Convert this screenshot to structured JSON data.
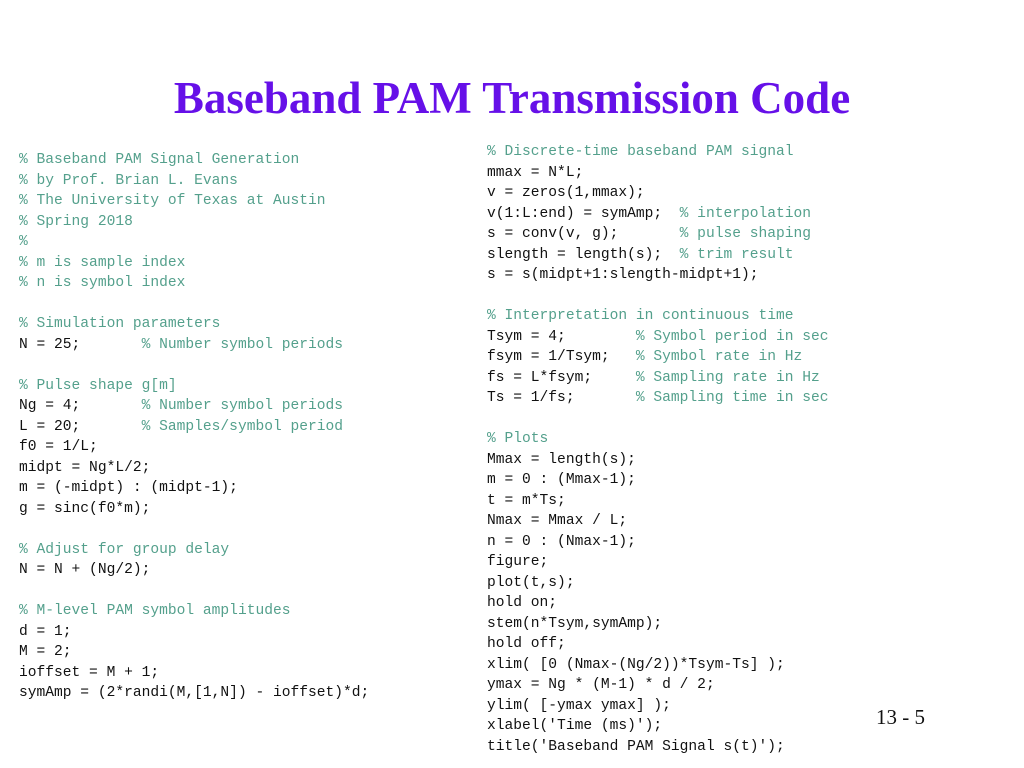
{
  "slide": {
    "title": "Baseband PAM Transmission Code",
    "title_color": "#6610E8",
    "background_color": "#ffffff",
    "page_number": "13 - 5"
  },
  "theme": {
    "code_color": "#111111",
    "comment_color": "#54A08C"
  },
  "code_left": {
    "lines": [
      [
        {
          "t": "comment",
          "s": "% Baseband PAM Signal Generation"
        }
      ],
      [
        {
          "t": "comment",
          "s": "% by Prof. Brian L. Evans"
        }
      ],
      [
        {
          "t": "comment",
          "s": "% The University of Texas at Austin"
        }
      ],
      [
        {
          "t": "comment",
          "s": "% Spring 2018"
        }
      ],
      [
        {
          "t": "comment",
          "s": "%"
        }
      ],
      [
        {
          "t": "comment",
          "s": "% m is sample index"
        }
      ],
      [
        {
          "t": "comment",
          "s": "% n is symbol index"
        }
      ],
      [
        {
          "t": "code",
          "s": ""
        }
      ],
      [
        {
          "t": "comment",
          "s": "% Simulation parameters"
        }
      ],
      [
        {
          "t": "code",
          "s": "N = 25;       "
        },
        {
          "t": "comment",
          "s": "% Number symbol periods"
        }
      ],
      [
        {
          "t": "code",
          "s": ""
        }
      ],
      [
        {
          "t": "comment",
          "s": "% Pulse shape g[m]"
        }
      ],
      [
        {
          "t": "code",
          "s": "Ng = 4;       "
        },
        {
          "t": "comment",
          "s": "% Number symbol periods"
        }
      ],
      [
        {
          "t": "code",
          "s": "L = 20;       "
        },
        {
          "t": "comment",
          "s": "% Samples/symbol period"
        }
      ],
      [
        {
          "t": "code",
          "s": "f0 = 1/L;"
        }
      ],
      [
        {
          "t": "code",
          "s": "midpt = Ng*L/2;"
        }
      ],
      [
        {
          "t": "code",
          "s": "m = (-midpt) : (midpt-1);"
        }
      ],
      [
        {
          "t": "code",
          "s": "g = sinc(f0*m);"
        }
      ],
      [
        {
          "t": "code",
          "s": ""
        }
      ],
      [
        {
          "t": "comment",
          "s": "% Adjust for group delay"
        }
      ],
      [
        {
          "t": "code",
          "s": "N = N + (Ng/2);"
        }
      ],
      [
        {
          "t": "code",
          "s": ""
        }
      ],
      [
        {
          "t": "comment",
          "s": "% M-level PAM symbol amplitudes"
        }
      ],
      [
        {
          "t": "code",
          "s": "d = 1;"
        }
      ],
      [
        {
          "t": "code",
          "s": "M = 2;"
        }
      ],
      [
        {
          "t": "code",
          "s": "ioffset = M + 1;"
        }
      ],
      [
        {
          "t": "code",
          "s": "symAmp = (2*randi(M,[1,N]) - ioffset)*d;"
        }
      ]
    ]
  },
  "code_right": {
    "lines": [
      [
        {
          "t": "comment",
          "s": "% Discrete-time baseband PAM signal"
        }
      ],
      [
        {
          "t": "code",
          "s": "mmax = N*L;"
        }
      ],
      [
        {
          "t": "code",
          "s": "v = zeros(1,mmax);"
        }
      ],
      [
        {
          "t": "code",
          "s": "v(1:L:end) = symAmp;  "
        },
        {
          "t": "comment",
          "s": "% interpolation"
        }
      ],
      [
        {
          "t": "code",
          "s": "s = conv(v, g);       "
        },
        {
          "t": "comment",
          "s": "% pulse shaping"
        }
      ],
      [
        {
          "t": "code",
          "s": "slength = length(s);  "
        },
        {
          "t": "comment",
          "s": "% trim result"
        }
      ],
      [
        {
          "t": "code",
          "s": "s = s(midpt+1:slength-midpt+1);"
        }
      ],
      [
        {
          "t": "code",
          "s": ""
        }
      ],
      [
        {
          "t": "comment",
          "s": "% Interpretation in continuous time"
        }
      ],
      [
        {
          "t": "code",
          "s": "Tsym = 4;        "
        },
        {
          "t": "comment",
          "s": "% Symbol period in sec"
        }
      ],
      [
        {
          "t": "code",
          "s": "fsym = 1/Tsym;   "
        },
        {
          "t": "comment",
          "s": "% Symbol rate in Hz"
        }
      ],
      [
        {
          "t": "code",
          "s": "fs = L*fsym;     "
        },
        {
          "t": "comment",
          "s": "% Sampling rate in Hz"
        }
      ],
      [
        {
          "t": "code",
          "s": "Ts = 1/fs;       "
        },
        {
          "t": "comment",
          "s": "% Sampling time in sec"
        }
      ],
      [
        {
          "t": "code",
          "s": ""
        }
      ],
      [
        {
          "t": "comment",
          "s": "% Plots"
        }
      ],
      [
        {
          "t": "code",
          "s": "Mmax = length(s);"
        }
      ],
      [
        {
          "t": "code",
          "s": "m = 0 : (Mmax-1);"
        }
      ],
      [
        {
          "t": "code",
          "s": "t = m*Ts;"
        }
      ],
      [
        {
          "t": "code",
          "s": "Nmax = Mmax / L;"
        }
      ],
      [
        {
          "t": "code",
          "s": "n = 0 : (Nmax-1);"
        }
      ],
      [
        {
          "t": "code",
          "s": "figure;"
        }
      ],
      [
        {
          "t": "code",
          "s": "plot(t,s);"
        }
      ],
      [
        {
          "t": "code",
          "s": "hold on;"
        }
      ],
      [
        {
          "t": "code",
          "s": "stem(n*Tsym,symAmp);"
        }
      ],
      [
        {
          "t": "code",
          "s": "hold off;"
        }
      ],
      [
        {
          "t": "code",
          "s": "xlim( [0 (Nmax-(Ng/2))*Tsym-Ts] );"
        }
      ],
      [
        {
          "t": "code",
          "s": "ymax = Ng * (M-1) * d / 2;"
        }
      ],
      [
        {
          "t": "code",
          "s": "ylim( [-ymax ymax] );"
        }
      ],
      [
        {
          "t": "code",
          "s": "xlabel('Time (ms)');"
        }
      ],
      [
        {
          "t": "code",
          "s": "title('Baseband PAM Signal s(t)');"
        }
      ]
    ]
  }
}
